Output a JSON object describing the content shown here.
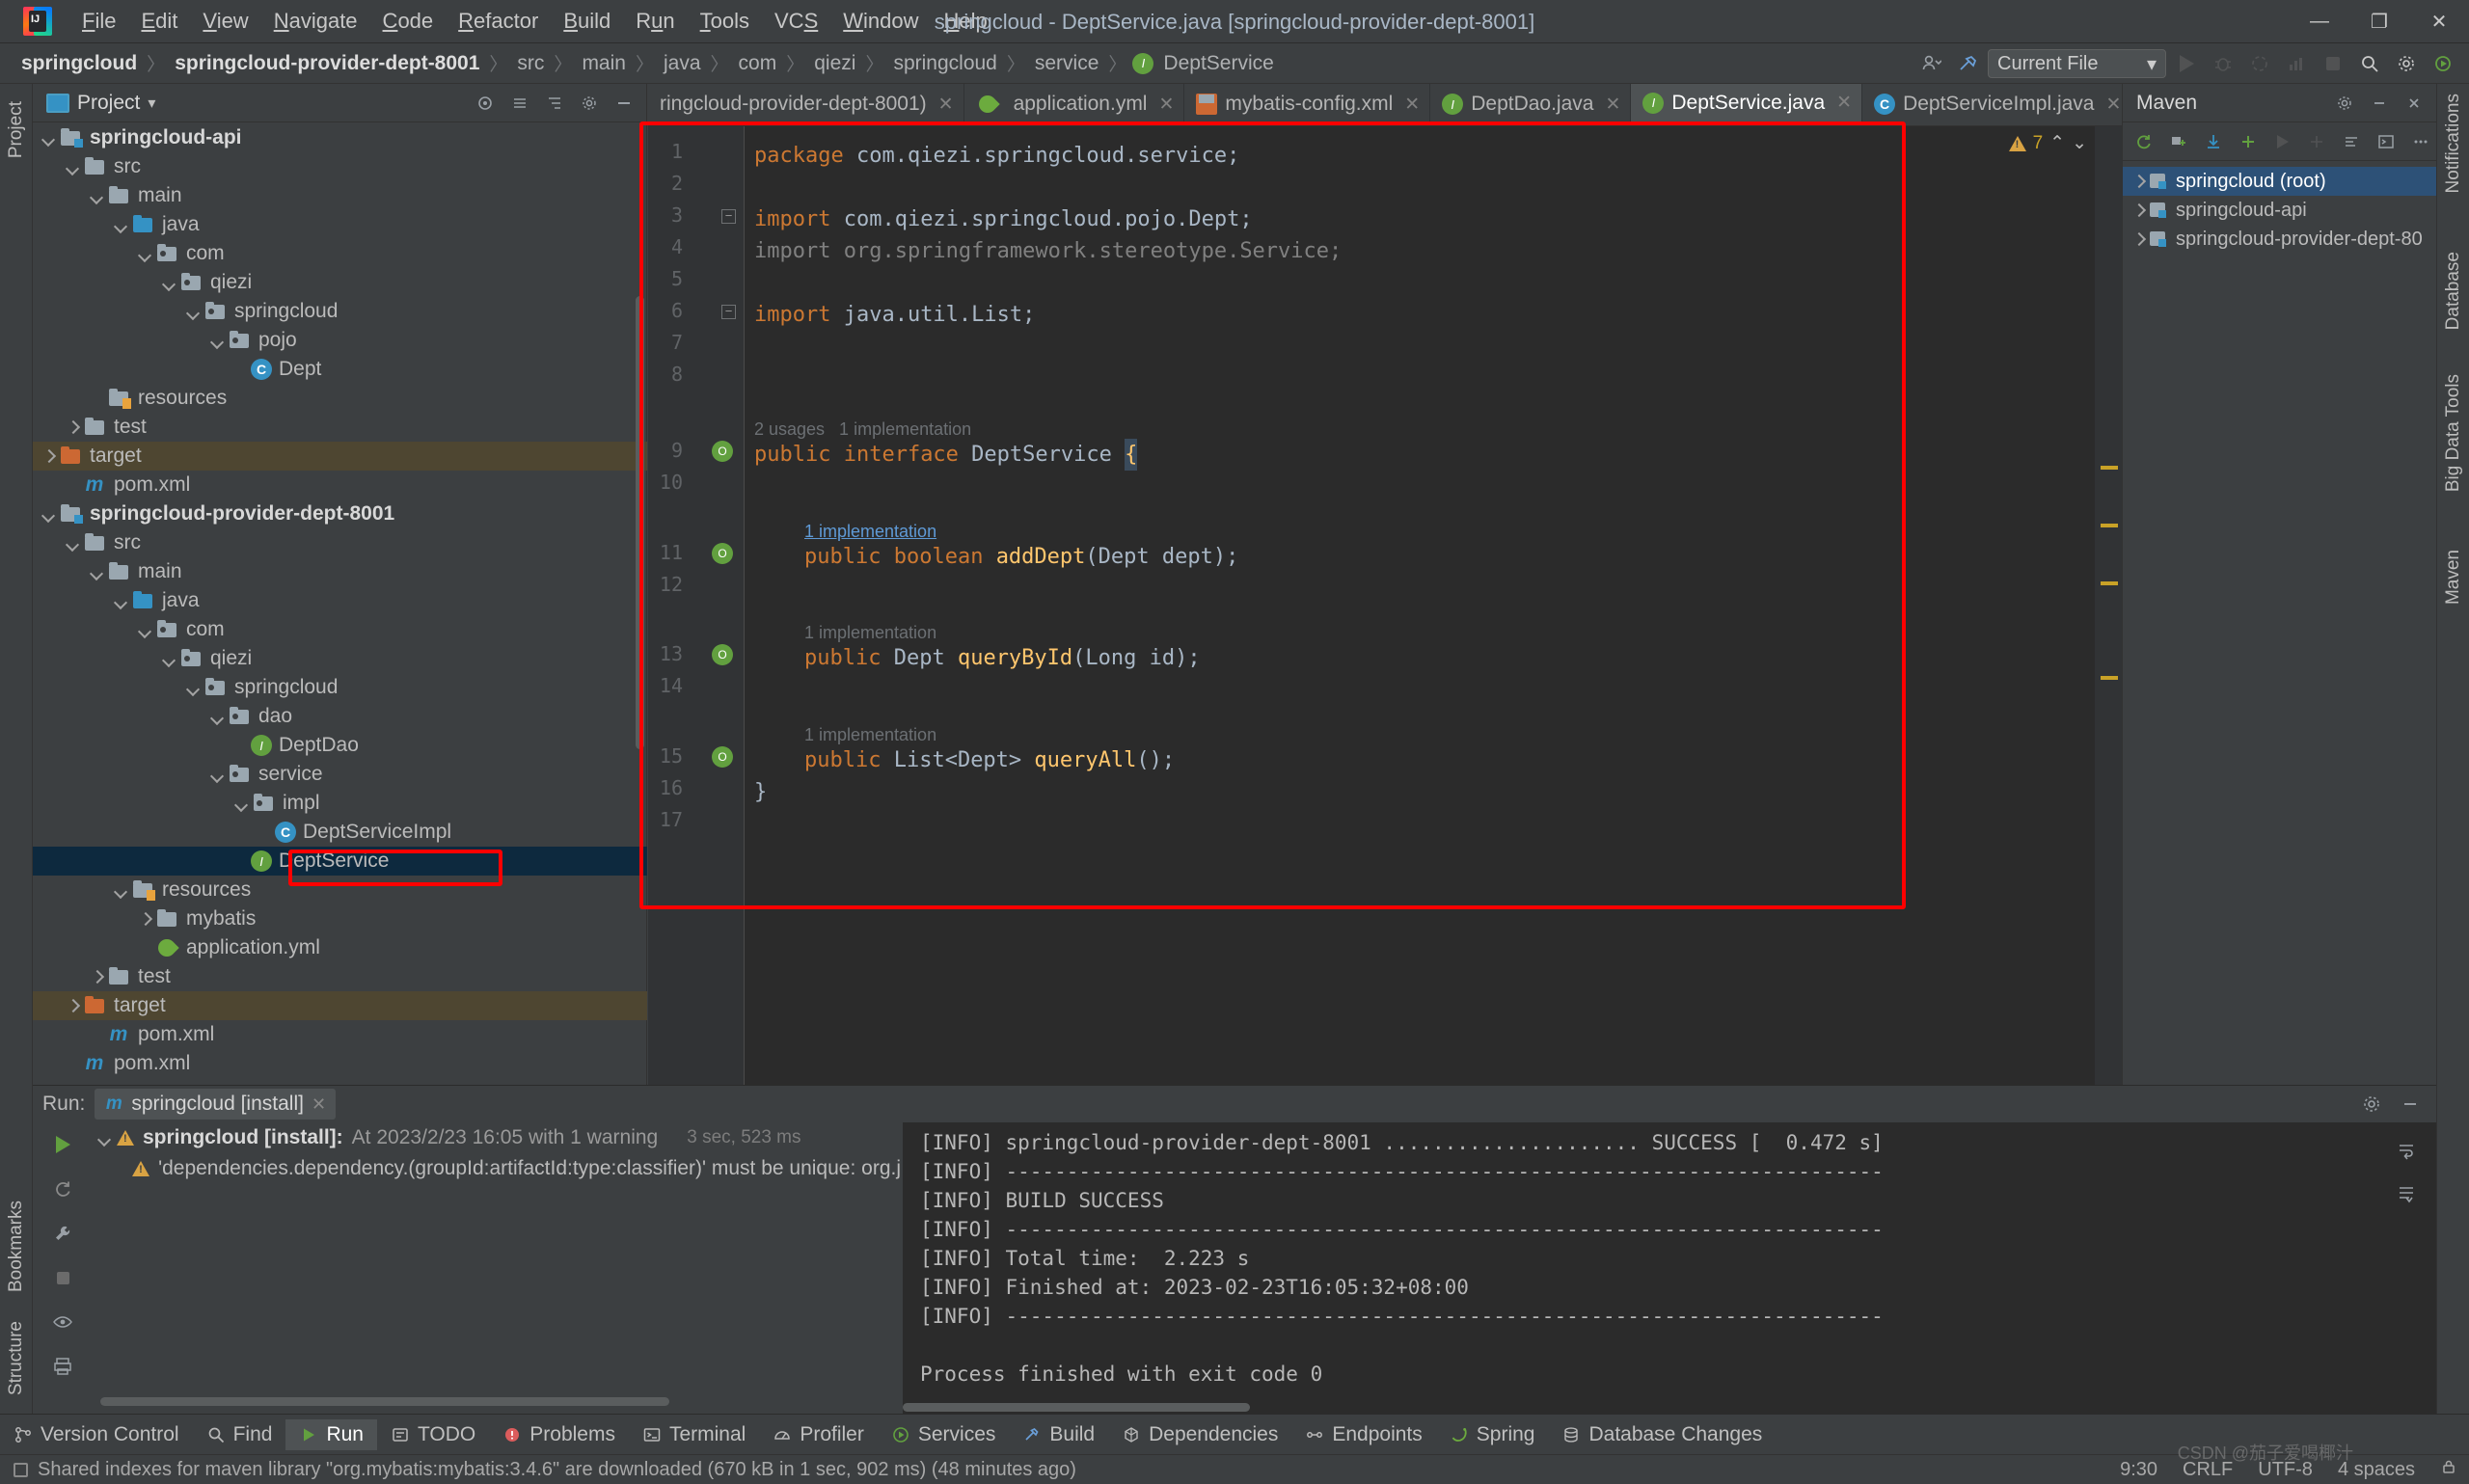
{
  "window": {
    "title": "springcloud - DeptService.java [springcloud-provider-dept-8001]",
    "minimize": "—",
    "maximize": "❐",
    "close": "✕"
  },
  "menu": [
    {
      "pre": "",
      "u": "F",
      "post": "ile"
    },
    {
      "pre": "",
      "u": "E",
      "post": "dit"
    },
    {
      "pre": "",
      "u": "V",
      "post": "iew"
    },
    {
      "pre": "",
      "u": "N",
      "post": "avigate"
    },
    {
      "pre": "",
      "u": "C",
      "post": "ode"
    },
    {
      "pre": "",
      "u": "R",
      "post": "efactor"
    },
    {
      "pre": "",
      "u": "B",
      "post": "uild"
    },
    {
      "pre": "R",
      "u": "u",
      "post": "n"
    },
    {
      "pre": "",
      "u": "T",
      "post": "ools"
    },
    {
      "pre": "VC",
      "u": "S",
      "post": ""
    },
    {
      "pre": "",
      "u": "W",
      "post": "indow"
    },
    {
      "pre": "",
      "u": "H",
      "post": "elp"
    }
  ],
  "breadcrumb": {
    "items": [
      {
        "label": "springcloud",
        "bold": true
      },
      {
        "label": "springcloud-provider-dept-8001",
        "bold": true
      },
      {
        "label": "src",
        "bold": false
      },
      {
        "label": "main",
        "bold": false
      },
      {
        "label": "java",
        "bold": false
      },
      {
        "label": "com",
        "bold": false
      },
      {
        "label": "qiezi",
        "bold": false
      },
      {
        "label": "springcloud",
        "bold": false
      },
      {
        "label": "service",
        "bold": false
      },
      {
        "label": "DeptService",
        "bold": false,
        "icon": "interface-icon"
      }
    ],
    "separator": "〉"
  },
  "nav_right": {
    "run_config": "Current File",
    "run_config_caret": "▾",
    "icons": [
      "user-icon",
      "hammer-icon",
      "run-icon",
      "debug-icon",
      "run-coverage-icon",
      "profiler-icon",
      "stop-icon",
      "search-icon",
      "settings-icon",
      "updates-icon"
    ]
  },
  "project_panel": {
    "title": "Project",
    "caret": "▾",
    "header_icons": [
      "target-icon",
      "collapse-all-icon",
      "expand-all-icon",
      "settings-icon",
      "hide-icon"
    ],
    "tree": [
      {
        "label": "springcloud-api",
        "depth": 2,
        "arrow": "down",
        "icon": "module-folder",
        "bold": true
      },
      {
        "label": "src",
        "depth": 3,
        "arrow": "down",
        "icon": "folder",
        "bold": false
      },
      {
        "label": "main",
        "depth": 4,
        "arrow": "down",
        "icon": "folder",
        "bold": false
      },
      {
        "label": "java",
        "depth": 5,
        "arrow": "down",
        "icon": "source-folder",
        "bold": false
      },
      {
        "label": "com",
        "depth": 6,
        "arrow": "down",
        "icon": "package-folder",
        "bold": false
      },
      {
        "label": "qiezi",
        "depth": 7,
        "arrow": "down",
        "icon": "package-folder",
        "bold": false
      },
      {
        "label": "springcloud",
        "depth": 8,
        "arrow": "down",
        "icon": "package-folder",
        "bold": false
      },
      {
        "label": "pojo",
        "depth": 9,
        "arrow": "down",
        "icon": "package-folder",
        "bold": false
      },
      {
        "label": "Dept",
        "depth": 10,
        "arrow": "none",
        "icon": "class-icon",
        "bold": false
      },
      {
        "label": "resources",
        "depth": 4,
        "arrow": "none",
        "icon": "resource-folder",
        "bold": false
      },
      {
        "label": "test",
        "depth": 3,
        "arrow": "right",
        "icon": "folder",
        "bold": false
      },
      {
        "label": "target",
        "depth": 2,
        "arrow": "right",
        "icon": "excluded-folder",
        "bold": false,
        "highlight": "yellow"
      },
      {
        "label": "pom.xml",
        "depth": 3,
        "arrow": "none",
        "icon": "maven-icon",
        "bold": false
      },
      {
        "label": "springcloud-provider-dept-8001",
        "depth": 2,
        "arrow": "down",
        "icon": "module-folder",
        "bold": true
      },
      {
        "label": "src",
        "depth": 3,
        "arrow": "down",
        "icon": "folder",
        "bold": false
      },
      {
        "label": "main",
        "depth": 4,
        "arrow": "down",
        "icon": "folder",
        "bold": false
      },
      {
        "label": "java",
        "depth": 5,
        "arrow": "down",
        "icon": "source-folder",
        "bold": false
      },
      {
        "label": "com",
        "depth": 6,
        "arrow": "down",
        "icon": "package-folder",
        "bold": false
      },
      {
        "label": "qiezi",
        "depth": 7,
        "arrow": "down",
        "icon": "package-folder",
        "bold": false
      },
      {
        "label": "springcloud",
        "depth": 8,
        "arrow": "down",
        "icon": "package-folder",
        "bold": false
      },
      {
        "label": "dao",
        "depth": 9,
        "arrow": "down",
        "icon": "package-folder",
        "bold": false
      },
      {
        "label": "DeptDao",
        "depth": 10,
        "arrow": "none",
        "icon": "interface-icon",
        "bold": false
      },
      {
        "label": "service",
        "depth": 9,
        "arrow": "down",
        "icon": "package-folder",
        "bold": false
      },
      {
        "label": "impl",
        "depth": 10,
        "arrow": "down",
        "icon": "package-folder",
        "bold": false
      },
      {
        "label": "DeptServiceImpl",
        "depth": 11,
        "arrow": "none",
        "icon": "class-icon",
        "bold": false
      },
      {
        "label": "DeptService",
        "depth": 10,
        "arrow": "none",
        "icon": "interface-icon",
        "bold": false,
        "highlight": "blue"
      },
      {
        "label": "resources",
        "depth": 5,
        "arrow": "down",
        "icon": "resource-folder",
        "bold": false
      },
      {
        "label": "mybatis",
        "depth": 6,
        "arrow": "right",
        "icon": "folder",
        "bold": false
      },
      {
        "label": "application.yml",
        "depth": 6,
        "arrow": "none",
        "icon": "yaml-icon",
        "bold": false
      },
      {
        "label": "test",
        "depth": 4,
        "arrow": "right",
        "icon": "folder",
        "bold": false
      },
      {
        "label": "target",
        "depth": 3,
        "arrow": "right",
        "icon": "excluded-folder",
        "bold": false,
        "highlight": "yellow"
      },
      {
        "label": "pom.xml",
        "depth": 4,
        "arrow": "none",
        "icon": "maven-icon",
        "bold": false
      },
      {
        "label": "pom.xml",
        "depth": 3,
        "arrow": "none",
        "icon": "maven-icon",
        "bold": false
      }
    ]
  },
  "editor_tabs": [
    {
      "label": "ringcloud-provider-dept-8001)",
      "icon": "none",
      "active": false,
      "close": "✕"
    },
    {
      "label": "application.yml",
      "icon": "yaml-icon",
      "active": false,
      "close": "✕"
    },
    {
      "label": "mybatis-config.xml",
      "icon": "xml-icon",
      "active": false,
      "close": "✕"
    },
    {
      "label": "DeptDao.java",
      "icon": "interface-icon",
      "active": false,
      "close": "✕"
    },
    {
      "label": "DeptService.java",
      "icon": "interface-icon",
      "active": true,
      "close": "✕"
    },
    {
      "label": "DeptServiceImpl.java",
      "icon": "class-icon",
      "active": false,
      "close": "✕"
    }
  ],
  "editor_tabs_right": [
    "pencil-icon",
    "chevron-down-icon",
    "more-icon"
  ],
  "editor": {
    "file": "DeptService.java",
    "inspection_count": "7",
    "inspection_up": "⌃",
    "inspection_down": "⌄",
    "lines": [
      {
        "num": 1,
        "indent": 0,
        "tokens": [
          {
            "t": "package ",
            "c": "kw"
          },
          {
            "t": "com.qiezi.springcloud.service;",
            "c": "pkg"
          }
        ]
      },
      {
        "num": 2,
        "indent": 0,
        "tokens": []
      },
      {
        "num": 3,
        "indent": 0,
        "fold": "minus",
        "tokens": [
          {
            "t": "import ",
            "c": "kw"
          },
          {
            "t": "com.qiezi.springcloud.pojo.Dept;",
            "c": "plain"
          }
        ]
      },
      {
        "num": 4,
        "indent": 0,
        "tokens": [
          {
            "t": "import org.springframework.stereotype.Service;",
            "c": "dim"
          }
        ]
      },
      {
        "num": 5,
        "indent": 0,
        "tokens": []
      },
      {
        "num": 6,
        "indent": 0,
        "fold": "minus",
        "tokens": [
          {
            "t": "import ",
            "c": "kw"
          },
          {
            "t": "java.util.List;",
            "c": "plain"
          }
        ]
      },
      {
        "num": 7,
        "indent": 0,
        "tokens": []
      },
      {
        "num": 8,
        "indent": 0,
        "tokens": []
      },
      {
        "num": 9,
        "indent": 0,
        "gutter": "impl-marker",
        "hint": "2 usages   1 implementation",
        "tokens": [
          {
            "t": "public ",
            "c": "kw"
          },
          {
            "t": "interface ",
            "c": "kw"
          },
          {
            "t": "DeptService ",
            "c": "plain"
          },
          {
            "t": "{",
            "c": "brace"
          }
        ]
      },
      {
        "num": 10,
        "indent": 0,
        "tokens": []
      },
      {
        "num": 11,
        "indent": 1,
        "gutter": "impl-marker",
        "hintlink": "1 implementation",
        "tokens": [
          {
            "t": "public ",
            "c": "kw"
          },
          {
            "t": "boolean ",
            "c": "kw"
          },
          {
            "t": "addDept",
            "c": "mth"
          },
          {
            "t": "(Dept dept);",
            "c": "plain"
          }
        ]
      },
      {
        "num": 12,
        "indent": 0,
        "tokens": []
      },
      {
        "num": 13,
        "indent": 1,
        "gutter": "impl-marker",
        "hint": "1 implementation",
        "tokens": [
          {
            "t": "public ",
            "c": "kw"
          },
          {
            "t": "Dept ",
            "c": "plain"
          },
          {
            "t": "queryById",
            "c": "mth"
          },
          {
            "t": "(Long id);",
            "c": "plain"
          }
        ]
      },
      {
        "num": 14,
        "indent": 0,
        "tokens": []
      },
      {
        "num": 15,
        "indent": 1,
        "gutter": "impl-marker",
        "hint": "1 implementation",
        "tokens": [
          {
            "t": "public ",
            "c": "kw"
          },
          {
            "t": "List<Dept> ",
            "c": "plain"
          },
          {
            "t": "queryAll",
            "c": "mth"
          },
          {
            "t": "();",
            "c": "plain"
          }
        ]
      },
      {
        "num": 16,
        "indent": 0,
        "tokens": [
          {
            "t": "}",
            "c": "brace"
          }
        ]
      },
      {
        "num": 17,
        "indent": 0,
        "tokens": []
      }
    ]
  },
  "maven_panel": {
    "title": "Maven",
    "header_icons": [
      "settings-icon",
      "minimize-icon",
      "hide-icon"
    ],
    "toolbar_icons": [
      "reload-icon",
      "add-all-icon",
      "download-icon",
      "plus-icon",
      "run-icon",
      "toggle-offline-icon",
      "skip-tests-icon",
      "execute-goal-icon",
      "more-icon"
    ],
    "tree": [
      {
        "label": "springcloud (root)",
        "arrow": "right",
        "selected": true
      },
      {
        "label": "springcloud-api",
        "arrow": "right",
        "selected": false
      },
      {
        "label": "springcloud-provider-dept-80",
        "arrow": "right",
        "selected": false
      }
    ]
  },
  "right_rail": [
    "Notifications",
    "Database",
    "Big Data Tools",
    "Maven"
  ],
  "left_rail": [
    "Project",
    "Structure",
    "Bookmarks"
  ],
  "run_panel": {
    "label": "Run:",
    "tab": "springcloud [install]",
    "tab_close": "✕",
    "right_icons": [
      "settings-icon",
      "minimize-icon",
      "hide-icon"
    ],
    "left_icons": [
      "run-icon",
      "rerun-icon",
      "wrench-icon",
      "stop-icon",
      "eye-icon",
      "print-icon"
    ],
    "tree": [
      {
        "type": "root",
        "arrow": "down",
        "warn": true,
        "label": "springcloud [install]:",
        "detail": "At 2023/2/23 16:05 with 1 warning",
        "time": "3 sec, 523 ms"
      },
      {
        "type": "child",
        "warn": true,
        "label": "'dependencies.dependency.(groupId:artifactId:type:classifier)' must be unique: org.j"
      }
    ],
    "console": [
      "[INFO] springcloud-provider-dept-8001 ..................... SUCCESS [  0.472 s]",
      "[INFO] ------------------------------------------------------------------------",
      "[INFO] BUILD SUCCESS",
      "[INFO] ------------------------------------------------------------------------",
      "[INFO] Total time:  2.223 s",
      "[INFO] Finished at: 2023-02-23T16:05:32+08:00",
      "[INFO] ------------------------------------------------------------------------",
      "",
      "Process finished with exit code 0"
    ]
  },
  "bottom_toolwindows": [
    {
      "label": "Version Control",
      "icon": "branch-icon",
      "active": false
    },
    {
      "label": "Find",
      "icon": "search-icon",
      "active": false
    },
    {
      "label": "Run",
      "icon": "run-icon",
      "active": true
    },
    {
      "label": "TODO",
      "icon": "todo-icon",
      "active": false
    },
    {
      "label": "Problems",
      "icon": "problems-icon",
      "active": false
    },
    {
      "label": "Terminal",
      "icon": "terminal-icon",
      "active": false
    },
    {
      "label": "Profiler",
      "icon": "profiler-icon",
      "active": false
    },
    {
      "label": "Services",
      "icon": "services-icon",
      "active": false
    },
    {
      "label": "Build",
      "icon": "build-icon",
      "active": false
    },
    {
      "label": "Dependencies",
      "icon": "dependencies-icon",
      "active": false
    },
    {
      "label": "Endpoints",
      "icon": "endpoints-icon",
      "active": false
    },
    {
      "label": "Spring",
      "icon": "spring-icon",
      "active": false
    },
    {
      "label": "Database Changes",
      "icon": "database-icon",
      "active": false
    }
  ],
  "status_bar": {
    "message": "Shared indexes for maven library \"org.mybatis:mybatis:3.4.6\" are downloaded (670 kB in 1 sec, 902 ms) (48 minutes ago)",
    "caret_position": "9:30",
    "line_separator": "CRLF",
    "encoding": "UTF-8",
    "indent": "4 spaces"
  },
  "watermark": "CSDN @茄子爱喝椰汁"
}
